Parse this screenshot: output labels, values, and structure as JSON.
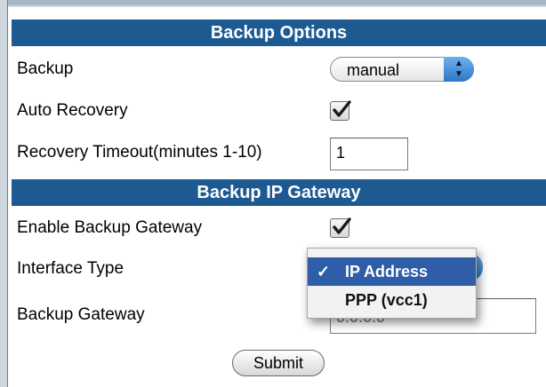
{
  "backup_options": {
    "header": "Backup Options",
    "backup_label": "Backup",
    "backup_value": "manual",
    "auto_recovery_label": "Auto Recovery",
    "auto_recovery_checked": true,
    "recovery_timeout_label": "Recovery Timeout(minutes 1-10)",
    "recovery_timeout_value": "1"
  },
  "backup_gateway": {
    "header": "Backup IP Gateway",
    "enable_label": "Enable Backup Gateway",
    "enable_checked": true,
    "interface_type_label": "Interface Type",
    "interface_options": [
      {
        "label": "IP Address",
        "selected": true
      },
      {
        "label": "PPP (vcc1)",
        "selected": false
      }
    ],
    "backup_gateway_label": "Backup Gateway",
    "backup_gateway_value": "0.0.0.0"
  },
  "actions": {
    "submit_label": "Submit"
  },
  "colors": {
    "header_bg": "#1e5a92",
    "menu_selected_bg": "#2f5ea8"
  }
}
